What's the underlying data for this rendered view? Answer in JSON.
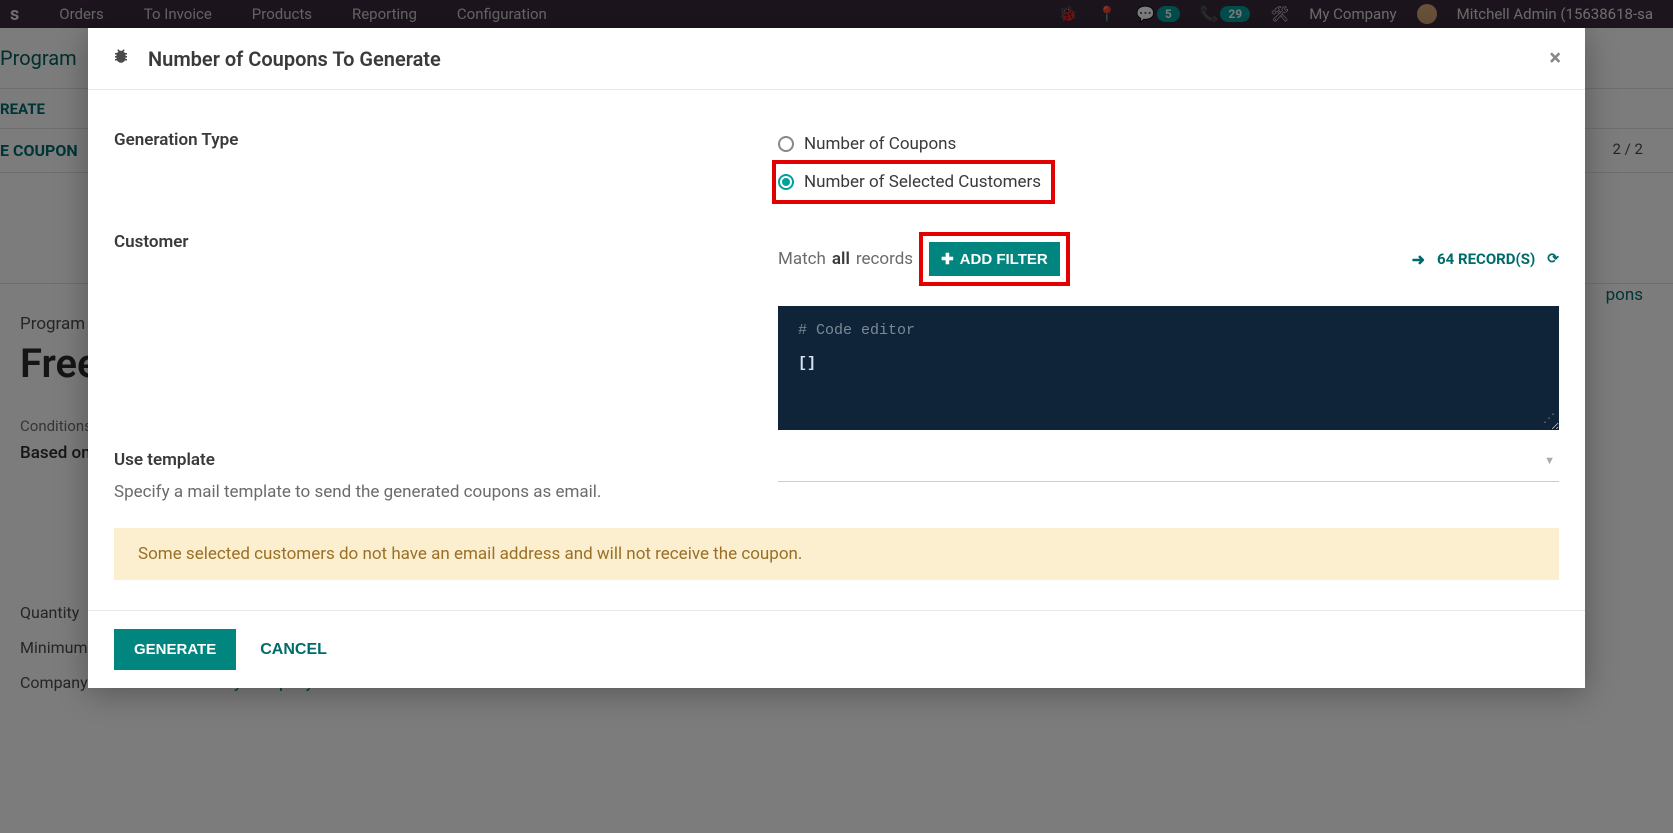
{
  "nav": {
    "items": [
      "Orders",
      "To Invoice",
      "Products",
      "Reporting",
      "Configuration"
    ],
    "badge1": "5",
    "badge2": "29",
    "company": "My Company",
    "user": "Mitchell Admin (15638618-sa"
  },
  "page": {
    "breadcrumb": "Program",
    "create": "REATE",
    "coupon_btn": "E COUPON",
    "pager": "2 / 2",
    "coupons_link": "pons",
    "program_label": "Program ",
    "program_name": "Free",
    "conditions": "Conditions",
    "based_on": "Based on",
    "quantity_label": "Quantity",
    "minimum_label": "Minimum",
    "company_label": "Company",
    "company_value": "My Company"
  },
  "modal": {
    "title": "Number of Coupons To Generate",
    "gen_type_label": "Generation Type",
    "radio1": "Number of Coupons",
    "radio2": "Number of Selected Customers",
    "customer_label": "Customer",
    "match_text": "Match ",
    "match_all": "all",
    "match_records": " records",
    "add_filter": "ADD FILTER",
    "records_count": "64 RECORD(S)",
    "code_comment": "# Code editor",
    "code_body": "[]",
    "template_label": "Use template",
    "template_help": "Specify a mail template to send the generated coupons as email.",
    "warning": "Some selected customers do not have an email address and will not receive the coupon.",
    "generate_btn": "GENERATE",
    "cancel_btn": "CANCEL"
  }
}
